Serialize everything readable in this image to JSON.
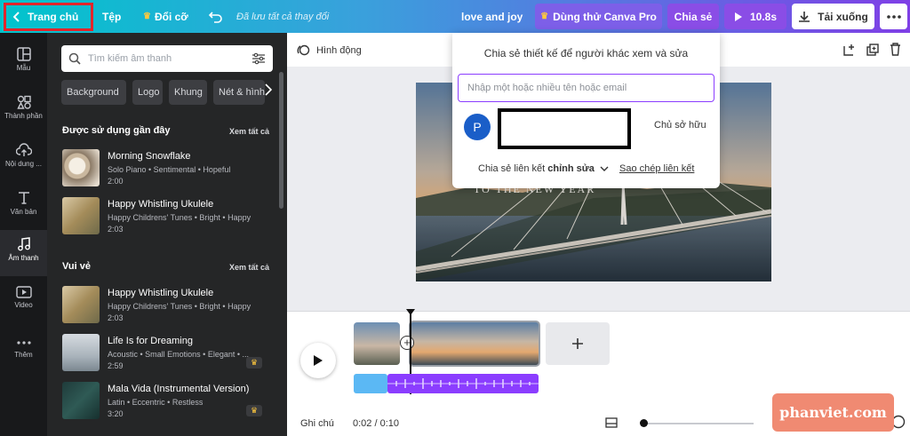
{
  "topbar": {
    "home": "Trang chủ",
    "file": "Tệp",
    "resize": "Đổi cỡ",
    "saved_status": "Đã lưu tất cả thay đổi",
    "design_title": "love and joy",
    "try_pro": "Dùng thử Canva Pro",
    "share": "Chia sẻ",
    "duration": "10.8s",
    "download": "Tải xuống"
  },
  "rail": [
    {
      "label": "Mẫu",
      "icon": "template-icon"
    },
    {
      "label": "Thành phần",
      "icon": "elements-icon"
    },
    {
      "label": "Nội dung ...",
      "icon": "upload-icon"
    },
    {
      "label": "Văn bản",
      "icon": "text-icon"
    },
    {
      "label": "Âm thanh",
      "icon": "music-icon"
    },
    {
      "label": "Video",
      "icon": "video-icon"
    },
    {
      "label": "Thêm",
      "icon": "more-icon"
    }
  ],
  "panel": {
    "search_placeholder": "Tìm kiếm âm thanh",
    "chips": [
      "Background",
      "Logo",
      "Khung",
      "Nét & hình"
    ],
    "recent_title": "Được sử dụng gần đây",
    "fun_title": "Vui vẻ",
    "see_all": "Xem tất cả",
    "recent": [
      {
        "title": "Morning Snowflake",
        "meta": "Solo Piano • Sentimental • Hopeful",
        "dur": "2:00"
      },
      {
        "title": "Happy Whistling Ukulele",
        "meta": "Happy Childrens' Tunes • Bright • Happy",
        "dur": "2:03"
      }
    ],
    "fun": [
      {
        "title": "Happy Whistling Ukulele",
        "meta": "Happy Childrens' Tunes • Bright • Happy",
        "dur": "2:03"
      },
      {
        "title": "Life Is for Dreaming",
        "meta": "Acoustic • Small Emotions • Elegant • ...",
        "dur": "2:59"
      },
      {
        "title": "Mala Vida (Instrumental Version)",
        "meta": "Latin • Eccentric • Restless",
        "dur": "3:20"
      }
    ]
  },
  "canvas": {
    "animate": "Hình động",
    "overlay_text": "TO THE NEW YEAR",
    "notes": "Ghi chú",
    "time": "0:02 / 0:10"
  },
  "share_popup": {
    "title": "Chia sẻ thiết kế để người khác xem và sửa",
    "email_placeholder": "Nhập một hoặc nhiều tên hoặc email",
    "avatar_letter": "P",
    "owner": "Chủ sở hữu",
    "link_prefix": "Chia sẻ liên kết",
    "link_mode": "chỉnh sửa",
    "copy_link": "Sao chép liên kết"
  },
  "watermark": "phanviet.com",
  "colors": {
    "accent": "#8b3dff",
    "highlight": "#e3252b",
    "pro_button": "#7d5fe8"
  }
}
